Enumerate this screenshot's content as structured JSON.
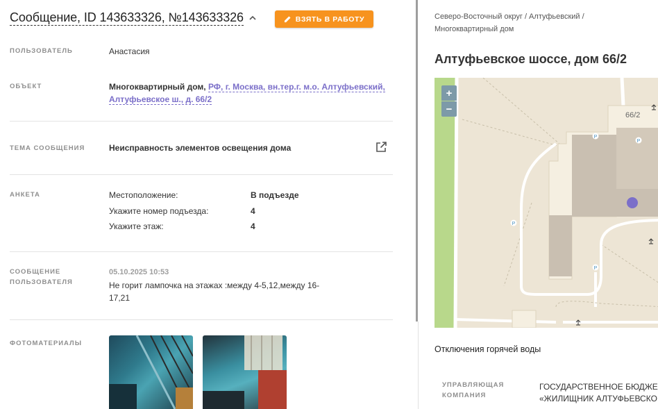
{
  "header": {
    "title": "Сообщение, ID 143633326, №143633326",
    "take_button": "ВЗЯТЬ В РАБОТУ"
  },
  "user": {
    "label": "ПОЛЬЗОВАТЕЛЬ",
    "value": "Анастасия"
  },
  "object": {
    "label": "ОБЪЕКТ",
    "type": "Многоквартирный дом,",
    "address_line1": "РФ, г. Москва, вн.тер.г. м.о. Алтуфьевский,",
    "address_line2": "Алтуфьевское ш., д. 66/2"
  },
  "topic": {
    "label": "ТЕМА СООБЩЕНИЯ",
    "value": "Неисправность элементов освещения дома"
  },
  "survey": {
    "label": "АНКЕТА",
    "items": [
      {
        "question": "Местоположение:",
        "answer": "В подъезде"
      },
      {
        "question": "Укажите номер подъезда:",
        "answer": "4"
      },
      {
        "question": "Укажите этаж:",
        "answer": "4"
      }
    ]
  },
  "message": {
    "label_line1": "СООБЩЕНИЕ",
    "label_line2": "ПОЛЬЗОВАТЕЛЯ",
    "date": "05.10.2025 10:53",
    "text": "Не горит лампочка на этажах :между 4-5,12,между 16-17,21"
  },
  "photos": {
    "label": "ФОТОМАТЕРИАЛЫ"
  },
  "side": {
    "breadcrumb_line1": "Северо-Восточный округ / Алтуфьевский /",
    "breadcrumb_line2": "Многоквартирный дом",
    "address_title": "Алтуфьевское шоссе, дом 66/2",
    "map_house_label": "66/2",
    "zoom_in": "+",
    "zoom_out": "−",
    "hot_water": "Отключения горячей воды",
    "mc_label_line1": "УПРАВЛЯЮЩАЯ",
    "mc_label_line2": "КОМПАНИЯ",
    "mc_value_line1": "ГОСУДАРСТВЕННОЕ БЮДЖЕТ",
    "mc_value_line2": "«ЖИЛИЩНИК АЛТУФЬЕВСКО"
  },
  "colors": {
    "accent": "#f7931e",
    "link": "#7b6fc9",
    "map_marker": "#7b6fc9"
  }
}
